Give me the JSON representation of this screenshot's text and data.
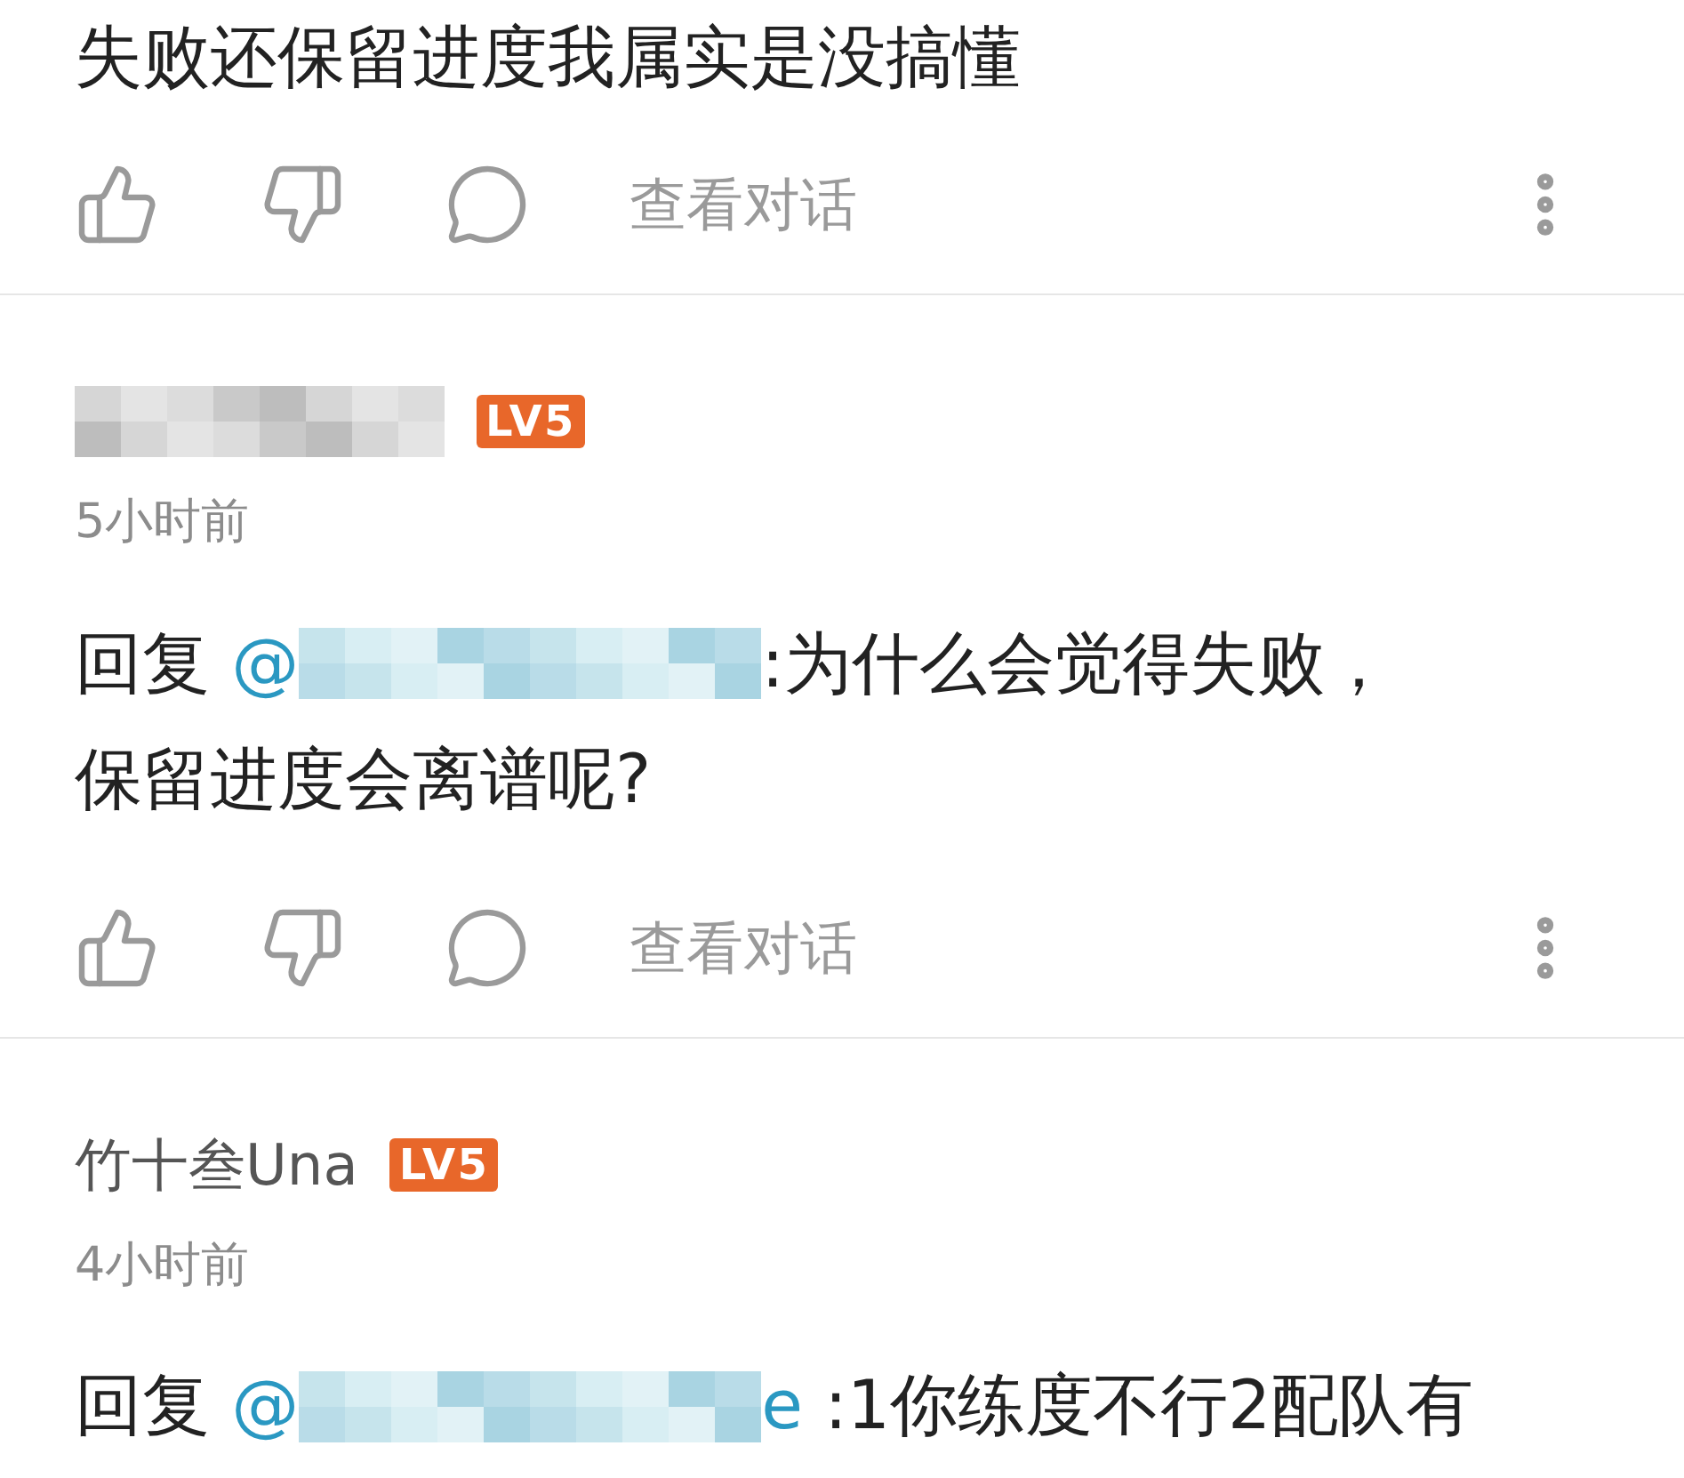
{
  "comments": [
    {
      "body": [
        [
          {
            "kind": "text",
            "text": "失败还保留进度我属实是没搞懂"
          }
        ]
      ],
      "actions": {
        "view_conversation": "查看对话"
      }
    },
    {
      "header": {
        "name": [
          {
            "kind": "redacted"
          }
        ],
        "badge": "LV5",
        "time": "5小时前"
      },
      "body": [
        [
          {
            "kind": "text",
            "text": "回复 "
          },
          {
            "kind": "mention",
            "text": "@"
          },
          {
            "kind": "redacted"
          },
          {
            "kind": "text",
            "text": ":为什么会觉得失败，"
          }
        ],
        [
          {
            "kind": "text",
            "text": "保留进度会离谱呢?"
          }
        ]
      ],
      "actions": {
        "view_conversation": "查看对话"
      }
    },
    {
      "header": {
        "name": [
          {
            "kind": "text",
            "text": "竹十叁Una"
          }
        ],
        "badge": "LV5",
        "time": "4小时前"
      },
      "body": [
        [
          {
            "kind": "text",
            "text": "回复 "
          },
          {
            "kind": "mention",
            "text": "@"
          },
          {
            "kind": "redacted"
          },
          {
            "kind": "mention",
            "text": "e"
          },
          {
            "kind": "text",
            "text": " :1你练度不行2配队有"
          }
        ]
      ]
    }
  ]
}
